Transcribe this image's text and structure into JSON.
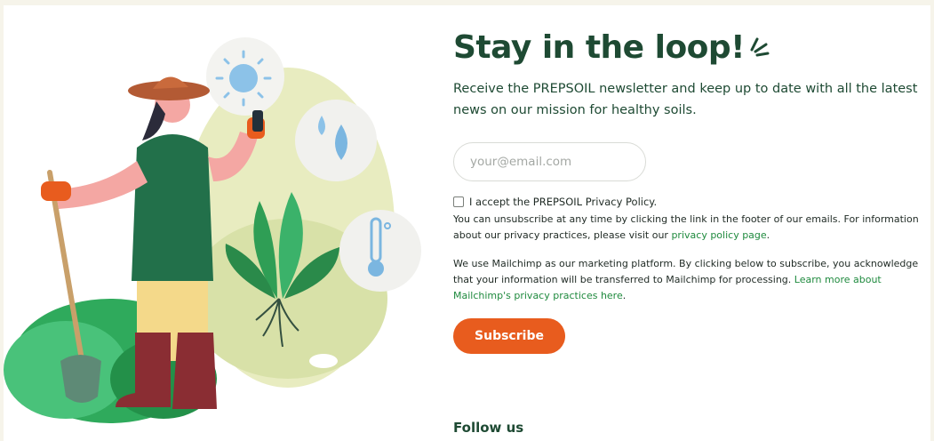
{
  "headline": "Stay in the loop!",
  "intro": "Receive the PREPSOIL newsletter and keep up to date with all the latest news on our mission for healthy soils.",
  "form": {
    "email_placeholder": "your@email.com",
    "consent_label": "I accept the PREPSOIL Privacy Policy.",
    "consent_checked": false,
    "unsubscribe_text": "You can unsubscribe at any time by clicking the link in the footer of our emails. For information about our privacy practices, please visit our ",
    "privacy_link": "privacy policy page",
    "unsubscribe_end": ".",
    "mailchimp_text": "We use Mailchimp as our marketing platform. By clicking below to subscribe, you acknowledge that your information will be transferred to Mailchimp for processing. ",
    "mailchimp_link": "Learn more about Mailchimp's privacy practices here",
    "mailchimp_end": ".",
    "subscribe_label": "Subscribe"
  },
  "follow_label": "Follow us",
  "colors": {
    "brand_green": "#1e4a33",
    "link_green": "#1f8a3e",
    "accent_orange": "#e85c1e",
    "page_bg": "#f6f4ea"
  },
  "illustration": {
    "icons": [
      "sun-icon",
      "water-drops-icon",
      "thermometer-icon"
    ],
    "subjects": [
      "gardener-with-phone",
      "shovel",
      "plant-with-roots"
    ]
  }
}
